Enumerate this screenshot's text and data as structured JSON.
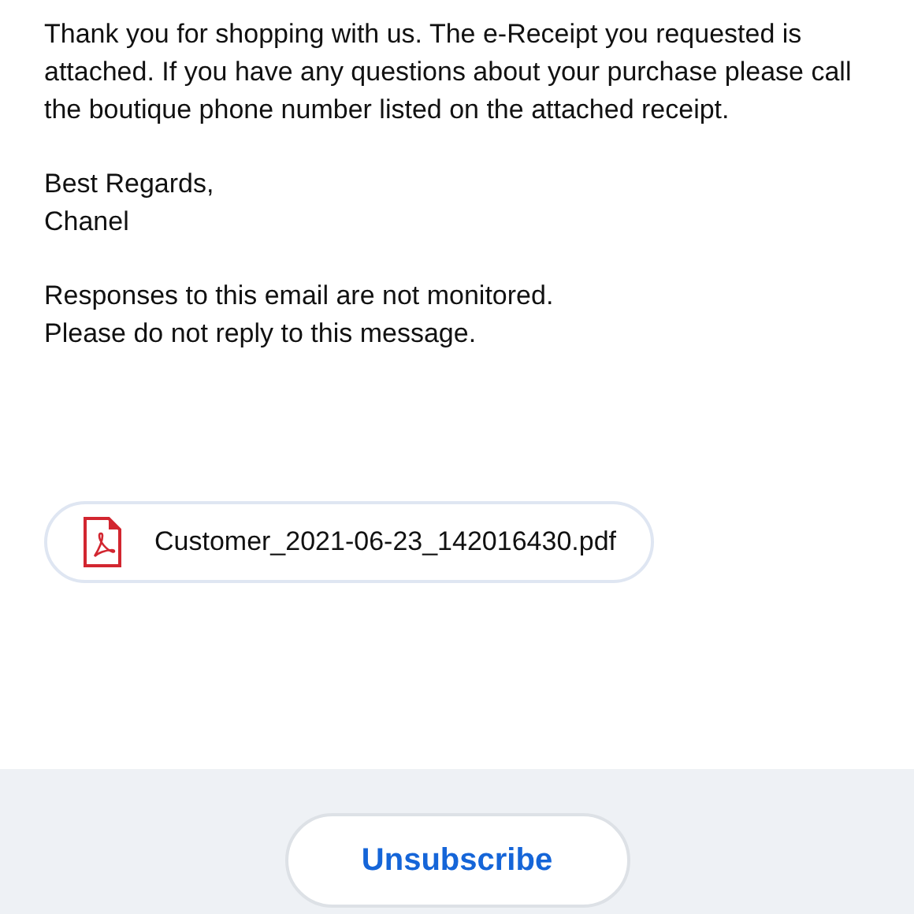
{
  "message": {
    "paragraphs": [
      "Thank you for shopping with us. The e-Receipt you requested is attached. If you have any questions about your purchase please call the boutique phone number listed on the attached receipt.",
      "Best Regards,\nChanel",
      "Responses to this email are not monitored.\nPlease do not reply to this message."
    ]
  },
  "attachment": {
    "filename": "Customer_2021-06-23_142016430.pdf"
  },
  "footer": {
    "button": "Unsubscribe"
  }
}
